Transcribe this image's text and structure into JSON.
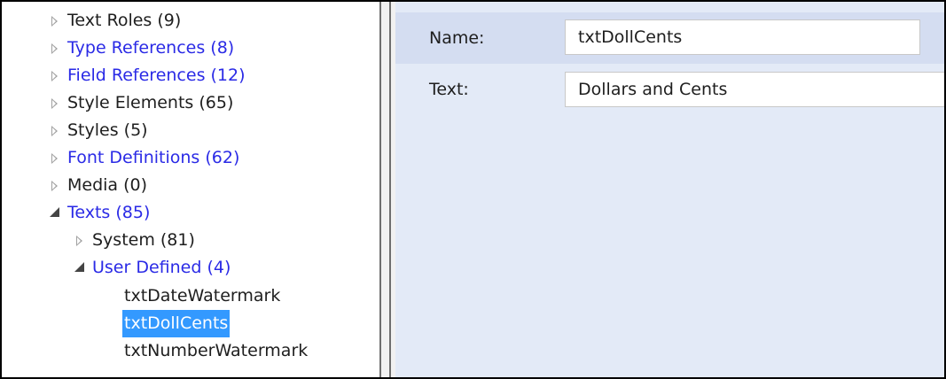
{
  "colors": {
    "link": "#2a2ae6",
    "selection": "#3399ff",
    "panel": "#e3eaf7"
  },
  "tree": {
    "items": [
      {
        "label": "Text Roles (9)",
        "state": "collapsed",
        "level": 0,
        "blue": false
      },
      {
        "label": "Type References (8)",
        "state": "collapsed",
        "level": 0,
        "blue": true
      },
      {
        "label": "Field References (12)",
        "state": "collapsed",
        "level": 0,
        "blue": true
      },
      {
        "label": "Style Elements (65)",
        "state": "collapsed",
        "level": 0,
        "blue": false
      },
      {
        "label": "Styles (5)",
        "state": "collapsed",
        "level": 0,
        "blue": false
      },
      {
        "label": "Font Definitions (62)",
        "state": "collapsed",
        "level": 0,
        "blue": true
      },
      {
        "label": "Media (0)",
        "state": "collapsed",
        "level": 0,
        "blue": false
      },
      {
        "label": "Texts (85)",
        "state": "expanded",
        "level": 0,
        "blue": true
      },
      {
        "label": "System (81)",
        "state": "collapsed",
        "level": 1,
        "blue": false
      },
      {
        "label": "User Defined (4)",
        "state": "expanded",
        "level": 1,
        "blue": true
      },
      {
        "label": "txtDateWatermark",
        "state": "leaf",
        "level": 2,
        "blue": false
      },
      {
        "label": "txtDollCents",
        "state": "leaf",
        "level": 2,
        "blue": false,
        "selected": true
      },
      {
        "label": "txtNumberWatermark",
        "state": "leaf",
        "level": 2,
        "blue": false
      }
    ]
  },
  "properties": {
    "name_label": "Name:",
    "name_value": "txtDollCents",
    "text_label": "Text:",
    "text_value": "Dollars and Cents"
  }
}
